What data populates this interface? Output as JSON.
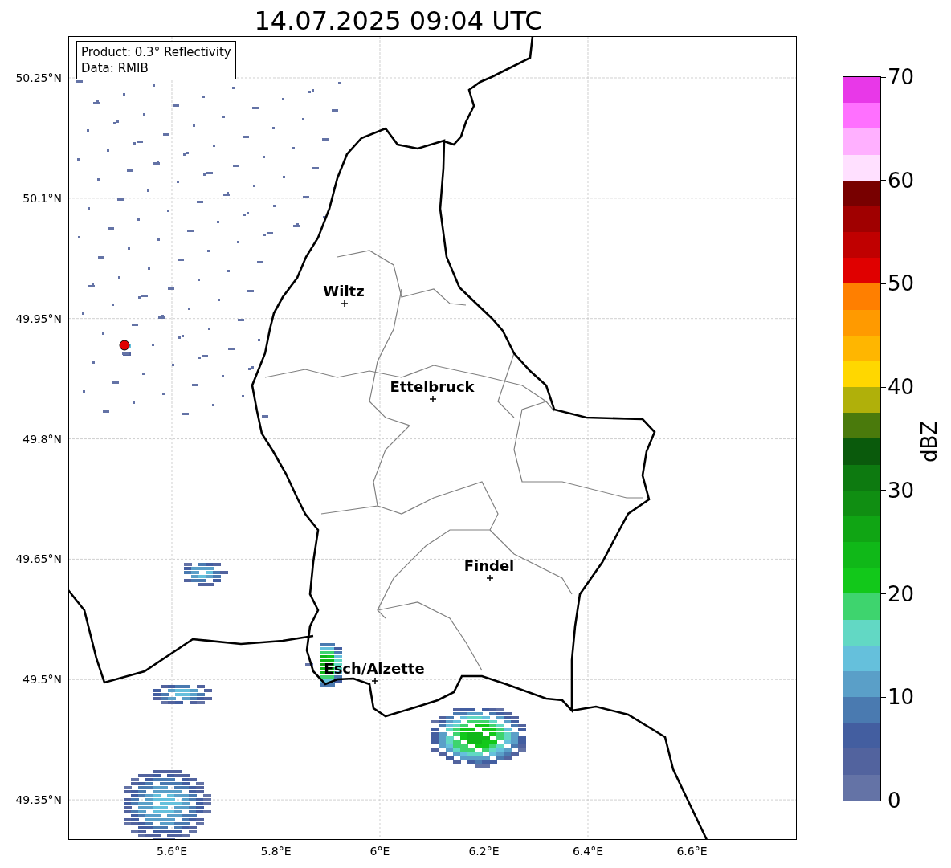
{
  "title": "14.07.2025 09:04 UTC",
  "info_box": {
    "lines": [
      "Product: 0.3° Reflectivity",
      "Data: RMIB"
    ]
  },
  "map": {
    "y_ticks": [
      "50.25°N",
      "50.1°N",
      "49.95°N",
      "49.8°N",
      "49.65°N",
      "49.5°N",
      "49.35°N"
    ],
    "x_ticks": [
      "5.6°E",
      "5.8°E",
      "6°E",
      "6.2°E",
      "6.4°E",
      "6.6°E"
    ],
    "cities": [
      {
        "name": "Wiltz"
      },
      {
        "name": "Ettelbruck"
      },
      {
        "name": "Findel"
      },
      {
        "name": "Esch/Alzette"
      }
    ]
  },
  "colorbar": {
    "label": "dBZ",
    "ticks": [
      "70",
      "60",
      "50",
      "40",
      "30",
      "20",
      "10",
      "0"
    ],
    "bins": [
      {
        "color": "#e838e8"
      },
      {
        "color": "#ff70ff"
      },
      {
        "color": "#ffb0ff"
      },
      {
        "color": "#ffe0ff"
      },
      {
        "color": "#780000"
      },
      {
        "color": "#a00000"
      },
      {
        "color": "#c00000"
      },
      {
        "color": "#e00000"
      },
      {
        "color": "#ff7f00"
      },
      {
        "color": "#ff9a00"
      },
      {
        "color": "#ffb600"
      },
      {
        "color": "#ffd700"
      },
      {
        "color": "#b0b00a"
      },
      {
        "color": "#4a7a0c"
      },
      {
        "color": "#0a5a0c"
      },
      {
        "color": "#0d7a10"
      },
      {
        "color": "#108e12"
      },
      {
        "color": "#10a514"
      },
      {
        "color": "#10b818"
      },
      {
        "color": "#12c81a"
      },
      {
        "color": "#3ed46e"
      },
      {
        "color": "#62d8c4"
      },
      {
        "color": "#65c0dc"
      },
      {
        "color": "#5a9fc8"
      },
      {
        "color": "#4a7ab0"
      },
      {
        "color": "#435ea0"
      },
      {
        "color": "#52639e"
      },
      {
        "color": "#6473a6"
      }
    ]
  }
}
